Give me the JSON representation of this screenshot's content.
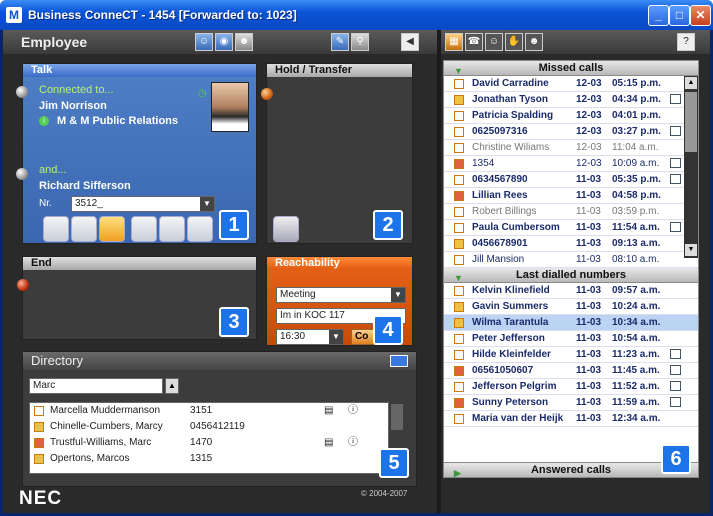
{
  "window": {
    "title": "Business ConneCT - 1454  [Forwarded to: 1023]",
    "minimize": "_",
    "maximize": "□",
    "close": "✕"
  },
  "employee": {
    "title": "Employee"
  },
  "talk": {
    "header": "Talk",
    "connected_label": "Connected to...",
    "contact_name": "Jim Norrison",
    "company": "M & M Public Relations",
    "and_label": "and...",
    "second_name": "Richard Sifferson",
    "nr_label": "Nr.",
    "nr_value": "3512_",
    "badge": "1"
  },
  "hold": {
    "header": "Hold / Transfer",
    "badge": "2"
  },
  "end": {
    "header": "End",
    "badge": "3"
  },
  "reachability": {
    "header": "Reachability",
    "status": "Meeting",
    "message": "Im in KOC 117",
    "time": "16:30",
    "button": "Co",
    "badge": "4"
  },
  "directory": {
    "header": "Directory",
    "search": "Marc",
    "badge": "5",
    "rows": [
      {
        "name": "Marcella Muddermanson",
        "num": "3151"
      },
      {
        "name": "Chinelle-Cumbers, Marcy",
        "num": "0456412119"
      },
      {
        "name": "Trustful-Williams, Marc",
        "num": "1470"
      },
      {
        "name": "Opertons, Marcos",
        "num": "1315"
      }
    ]
  },
  "brand": {
    "logo": "NEC",
    "copyright": "© 2004-2007"
  },
  "right": {
    "help": "?",
    "badge": "6",
    "missed_header": "Missed calls",
    "missed": [
      {
        "name": "David Carradine",
        "date": "12-03",
        "time": "05:15 p.m.",
        "style": "bold"
      },
      {
        "name": "Jonathan Tyson",
        "date": "12-03",
        "time": "04:34 p.m.",
        "style": "bold"
      },
      {
        "name": "Patricia Spalding",
        "date": "12-03",
        "time": "04:01 p.m.",
        "style": "bold"
      },
      {
        "name": "0625097316",
        "date": "12-03",
        "time": "03:27 p.m.",
        "style": "bold"
      },
      {
        "name": "Christine Wiliams",
        "date": "12-03",
        "time": "11:04 a.m.",
        "style": "grey"
      },
      {
        "name": "1354",
        "date": "12-03",
        "time": "10:09 a.m.",
        "style": "normal"
      },
      {
        "name": "0634567890",
        "date": "11-03",
        "time": "05:35 p.m.",
        "style": "bold"
      },
      {
        "name": "Lillian Rees",
        "date": "11-03",
        "time": "04:58 p.m.",
        "style": "bold"
      },
      {
        "name": "Robert Billings",
        "date": "11-03",
        "time": "03:59 p.m.",
        "style": "grey"
      },
      {
        "name": "Paula Cumbersom",
        "date": "11-03",
        "time": "11:54 a.m.",
        "style": "bold"
      },
      {
        "name": "0456678901",
        "date": "11-03",
        "time": "09:13 a.m.",
        "style": "bold"
      },
      {
        "name": "Jill Mansion",
        "date": "11-03",
        "time": "08:10 a.m.",
        "style": "normal"
      }
    ],
    "dialled_header": "Last dialled numbers",
    "dialled": [
      {
        "name": "Kelvin Klinefield",
        "date": "11-03",
        "time": "09:57 a.m."
      },
      {
        "name": "Gavin Summers",
        "date": "11-03",
        "time": "10:24 a.m."
      },
      {
        "name": "Wilma Tarantula",
        "date": "11-03",
        "time": "10:34 a.m."
      },
      {
        "name": "Peter Jefferson",
        "date": "11-03",
        "time": "10:54 a.m."
      },
      {
        "name": "Hilde Kleinfelder",
        "date": "11-03",
        "time": "11:23 a.m."
      },
      {
        "name": "06561050607",
        "date": "11-03",
        "time": "11:45 a.m."
      },
      {
        "name": "Jefferson Pelgrim",
        "date": "11-03",
        "time": "11:52 a.m."
      },
      {
        "name": "Sunny Peterson",
        "date": "11-03",
        "time": "11:59 a.m."
      },
      {
        "name": "Maria van der Heijk",
        "date": "11-03",
        "time": "12:34 a.m."
      }
    ],
    "answered_header": "Answered calls"
  }
}
